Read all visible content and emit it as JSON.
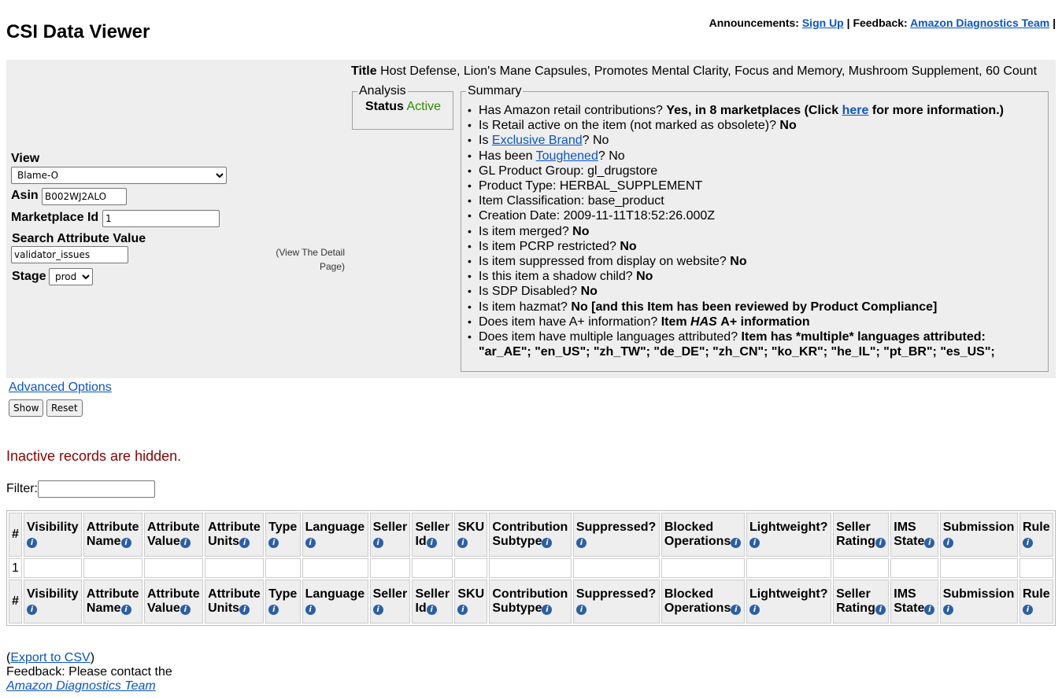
{
  "header": {
    "title": "CSI Data Viewer",
    "announcements_label": "Announcements:",
    "signup_link": "Sign Up",
    "feedback_label": "Feedback:",
    "feedback_link": "Amazon Diagnostics Team",
    "sep": "|"
  },
  "form": {
    "view_label": "View",
    "view_value": "Blame-O",
    "asin_label": "Asin",
    "asin_value": "B002WJ2ALO",
    "marketplace_label": "Marketplace Id",
    "marketplace_value": "1",
    "search_label": "Search Attribute Value",
    "search_value": "validator_issues",
    "stage_label": "Stage",
    "stage_value": "prod",
    "detail_link": "(View The Detail Page)"
  },
  "item": {
    "title_label": "Title",
    "title_value": "Host Defense, Lion's Mane Capsules, Promotes Mental Clarity, Focus and Memory, Mushroom Supplement, 60 Count"
  },
  "analysis": {
    "legend": "Analysis",
    "status_label": "Status",
    "status_value": "Active",
    "status_color": "#2e8b00"
  },
  "summary": {
    "legend": "Summary",
    "retail_q": "Has Amazon retail contributions?",
    "retail_a1": "Yes, in 8 marketplaces (Click",
    "retail_link": "here",
    "retail_a2": "for more information.)",
    "obsolete_q": "Is Retail active on the item (not marked as obsolete)?",
    "obsolete_a": "No",
    "exclusive_pre": "Is",
    "exclusive_link": "Exclusive Brand",
    "exclusive_post": "? No",
    "toughened_pre": "Has been",
    "toughened_link": "Toughened",
    "toughened_post": "? No",
    "gl": "GL Product Group: gl_drugstore",
    "product_type": "Product Type: HERBAL_SUPPLEMENT",
    "classification": "Item Classification: base_product",
    "creation_date": "Creation Date: 2009-11-11T18:52:26.000Z",
    "merged_q": "Is item merged?",
    "merged_a": "No",
    "pcrp_q": "Is item PCRP restricted?",
    "pcrp_a": "No",
    "suppressed_q": "Is item suppressed from display on website?",
    "suppressed_a": "No",
    "shadow_q": "Is this item a shadow child?",
    "shadow_a": "No",
    "sdp_q": "Is SDP Disabled?",
    "sdp_a": "No",
    "hazmat_q": "Is item hazmat?",
    "hazmat_a": "No [and this Item has been reviewed by Product Compliance]",
    "aplus_q": "Does item have A+ information?",
    "aplus_a1": "Item",
    "aplus_a2": "HAS",
    "aplus_a3": "A+ information",
    "lang_q": "Does item have multiple languages attributed?",
    "lang_a": "Item has *multiple* languages attributed:",
    "lang_list": "\"ar_AE\"; \"en_US\"; \"zh_TW\"; \"de_DE\"; \"zh_CN\"; \"ko_KR\"; \"he_IL\"; \"pt_BR\"; \"es_US\";"
  },
  "controls": {
    "advanced_options": "Advanced Options",
    "show": "Show",
    "reset": "Reset",
    "inactive_msg": "Inactive records are hidden.",
    "filter_label": "Filter:"
  },
  "table": {
    "columns": [
      {
        "l1": "#",
        "l2": ""
      },
      {
        "l1": "Visibility",
        "l2": ""
      },
      {
        "l1": "Attribute",
        "l2": "Name"
      },
      {
        "l1": "Attribute",
        "l2": "Value"
      },
      {
        "l1": "Attribute",
        "l2": "Units"
      },
      {
        "l1": "Type",
        "l2": ""
      },
      {
        "l1": "Language",
        "l2": ""
      },
      {
        "l1": "Seller",
        "l2": ""
      },
      {
        "l1": "Seller",
        "l2": "Id"
      },
      {
        "l1": "SKU",
        "l2": ""
      },
      {
        "l1": "Contribution",
        "l2": "Subtype"
      },
      {
        "l1": "Suppressed?",
        "l2": ""
      },
      {
        "l1": "Blocked",
        "l2": "Operations"
      },
      {
        "l1": "Lightweight?",
        "l2": ""
      },
      {
        "l1": "Seller",
        "l2": "Rating"
      },
      {
        "l1": "IMS",
        "l2": "State"
      },
      {
        "l1": "Submission",
        "l2": ""
      },
      {
        "l1": "Rule",
        "l2": ""
      }
    ],
    "rows": [
      [
        "1",
        "",
        "",
        "",
        "",
        "",
        "",
        "",
        "",
        "",
        "",
        "",
        "",
        "",
        "",
        "",
        "",
        ""
      ]
    ]
  },
  "footer": {
    "export_open": "(",
    "export_link": "Export to CSV",
    "export_close": ")",
    "feedback_text": "Feedback: Please contact the",
    "feedback_link": "Amazon Diagnostics Team"
  },
  "icons": {
    "info": "info-icon"
  }
}
